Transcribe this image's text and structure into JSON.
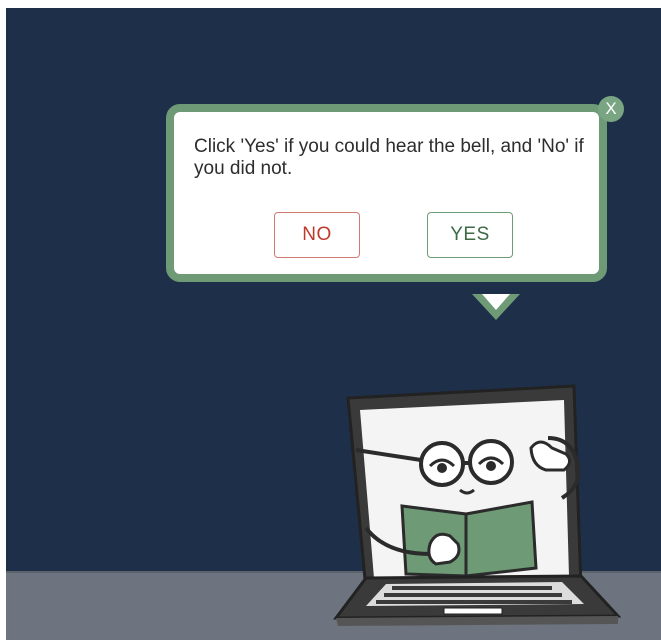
{
  "dialog": {
    "message": "Click 'Yes' if you could hear the bell, and 'No' if you did not.",
    "no_label": "NO",
    "yes_label": "YES",
    "close_label": "X"
  },
  "colors": {
    "background": "#1e3049",
    "floor": "#6e747f",
    "dialog_border": "#6e9a76",
    "no_accent": "#c0392b",
    "yes_accent": "#3b6b46"
  },
  "icons": {
    "close": "close-icon",
    "mascot": "laptop-reader-illustration"
  }
}
